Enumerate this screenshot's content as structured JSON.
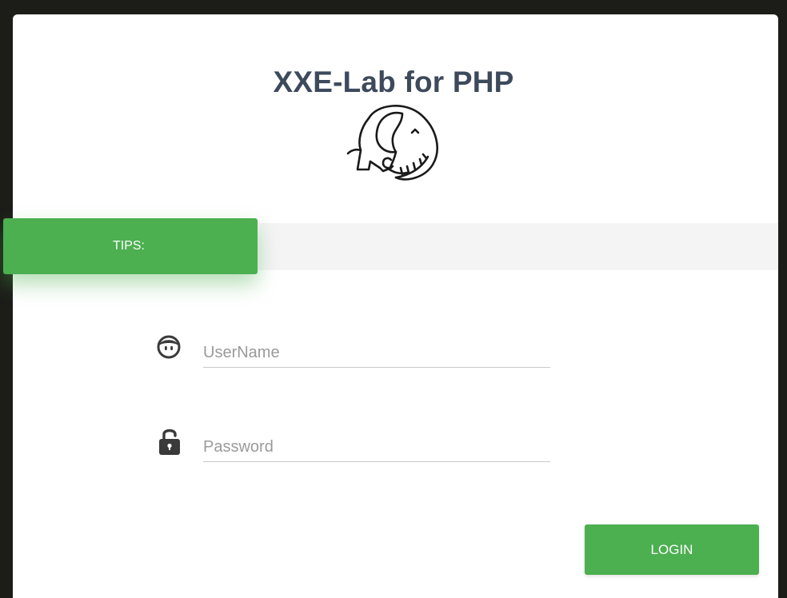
{
  "header": {
    "title": "XXE-Lab for PHP",
    "logo_icon": "php-elephant-icon"
  },
  "tips": {
    "label": "TIPS:",
    "message": ""
  },
  "form": {
    "username": {
      "placeholder": "UserName",
      "value": "",
      "icon": "user-face-icon"
    },
    "password": {
      "placeholder": "Password",
      "value": "",
      "icon": "unlock-icon"
    },
    "login_label": "LOGIN"
  },
  "colors": {
    "accent": "#4caf50",
    "title": "#3d4a5c",
    "background": "#1c1c18",
    "card": "#ffffff",
    "tips_strip": "#f4f4f4"
  }
}
